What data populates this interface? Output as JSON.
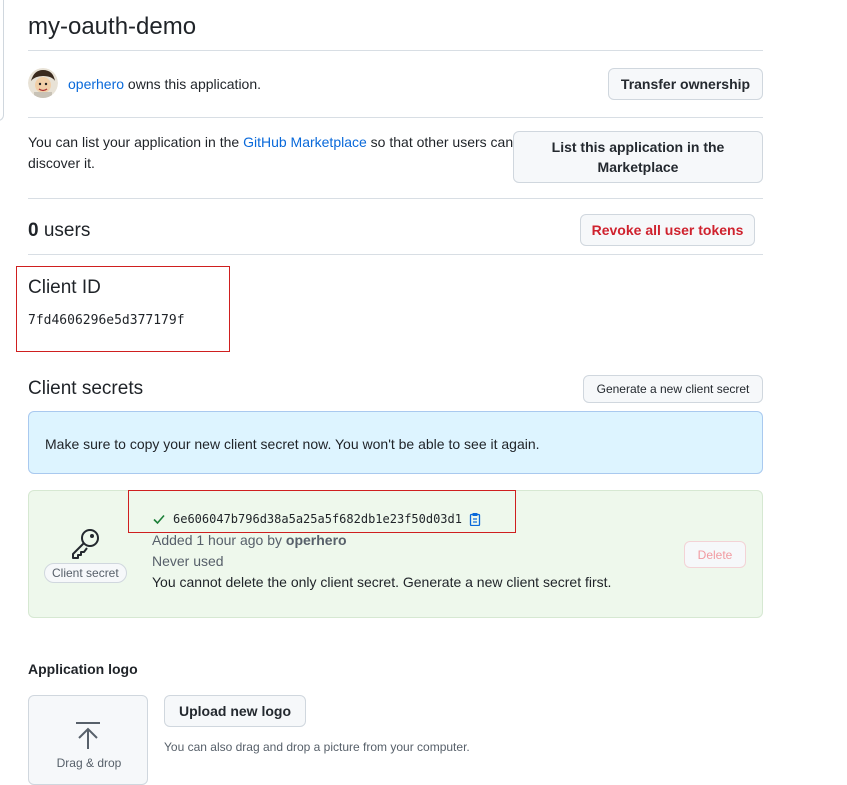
{
  "app": {
    "title": "my-oauth-demo",
    "owner": {
      "name": "operhero",
      "suffix": " owns this application."
    },
    "transfer_label": "Transfer ownership"
  },
  "marketplace": {
    "text_before": "You can list your application in the ",
    "link": "GitHub Marketplace",
    "text_after": " so that other users can discover it.",
    "button_label": "List this application in the Marketplace"
  },
  "users": {
    "count": "0",
    "label": " users",
    "revoke_label": "Revoke all user tokens"
  },
  "client_id": {
    "heading": "Client ID",
    "value": "7fd4606296e5d377179f"
  },
  "client_secrets": {
    "heading": "Client secrets",
    "generate_label": "Generate a new client secret",
    "notice": "Make sure to copy your new client secret now. You won't be able to see it again.",
    "secret": {
      "badge": "Client secret",
      "value": "6e606047b796d38a5a25a5f682db1e23f50d03d1",
      "added_prefix": "Added 1 hour ago by ",
      "added_by": "operhero",
      "usage": "Never used",
      "warning": "You cannot delete the only client secret. Generate a new client secret first.",
      "delete_label": "Delete"
    }
  },
  "logo": {
    "heading": "Application logo",
    "upload_label": "Upload new logo",
    "hint": "You can also drag and drop a picture from your computer.",
    "dropzone_label": "Drag & drop"
  },
  "colors": {
    "link": "#0969da",
    "danger": "#cf222e",
    "success": "#1a7f37",
    "notice_bg": "#ddf4ff",
    "secret_bg": "#eef8ec"
  }
}
